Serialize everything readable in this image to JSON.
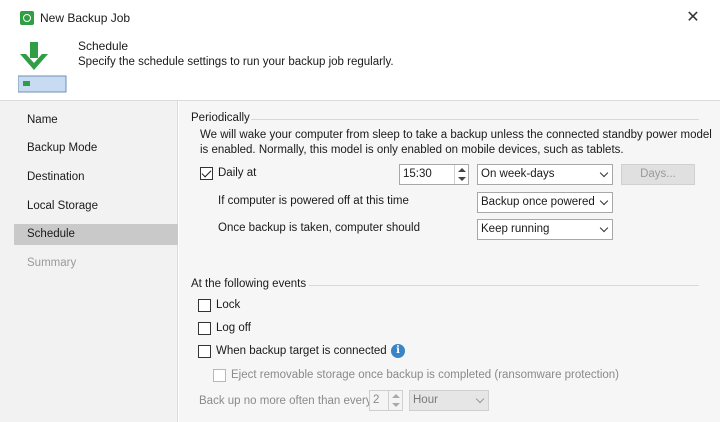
{
  "window": {
    "title": "New Backup Job",
    "close_glyph": "✕"
  },
  "header": {
    "title": "Schedule",
    "description": "Specify the schedule settings to run your backup job regularly.",
    "icon": "download-arrow-icon"
  },
  "sidebar": {
    "items": [
      {
        "label": "Name",
        "state": "normal"
      },
      {
        "label": "Backup Mode",
        "state": "normal"
      },
      {
        "label": "Destination",
        "state": "normal"
      },
      {
        "label": "Local Storage",
        "state": "normal"
      },
      {
        "label": "Schedule",
        "state": "active"
      },
      {
        "label": "Summary",
        "state": "disabled"
      }
    ]
  },
  "periodically": {
    "section_title": "Periodically",
    "note_line1": "We will wake your computer from sleep to take a backup unless the connected standby power model",
    "note_line2": "is enabled. Normally, this model is only enabled on mobile devices, such as tablets.",
    "daily_at_label": "Daily at",
    "daily_at_checked": true,
    "time_value": "15:30",
    "frequency_value": "On week-days",
    "days_button": "Days...",
    "powered_off_label": "If computer is powered off at this time",
    "powered_off_value": "Backup once powered on",
    "after_backup_label": "Once backup is taken, computer should",
    "after_backup_value": "Keep running"
  },
  "events": {
    "section_title": "At the following events",
    "lock_label": "Lock",
    "logoff_label": "Log off",
    "target_connected_label": "When backup target is connected",
    "eject_label": "Eject removable storage once backup is completed (ransomware protection)",
    "limit_label": "Back up no more often than every",
    "limit_value": "2",
    "limit_unit": "Hour"
  },
  "colors": {
    "accent_green": "#2f9e44",
    "info_blue": "#3a84c6",
    "sidebar_active": "#c9c9c9"
  }
}
